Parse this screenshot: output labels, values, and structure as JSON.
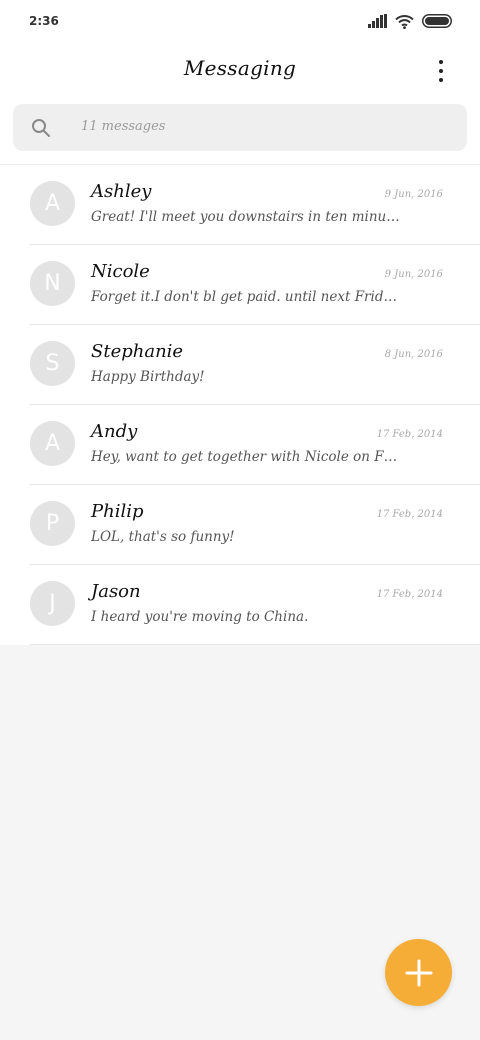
{
  "status_bar": {
    "time": "2:36",
    "icons": [
      "signal-icon",
      "wifi-icon",
      "battery-icon"
    ]
  },
  "header": {
    "title": "Messaging",
    "more_icon": "more-vertical-icon"
  },
  "search": {
    "placeholder": "11 messages",
    "icon": "search-icon"
  },
  "conversations": [
    {
      "initial": "A",
      "name": "Ashley",
      "date": "9 Jun, 2016",
      "preview": "Great! I'll meet you downstairs in ten minutes...."
    },
    {
      "initial": "N",
      "name": "Nicole",
      "date": "9 Jun, 2016",
      "preview": "Forget it.I don't bl get paid. until next Friday."
    },
    {
      "initial": "S",
      "name": "Stephanie",
      "date": "8 Jun, 2016",
      "preview": "Happy Birthday!"
    },
    {
      "initial": "A",
      "name": "Andy",
      "date": "17 Feb, 2014",
      "preview": "Hey, want to get together with Nicole on Frid..."
    },
    {
      "initial": "P",
      "name": "Philip",
      "date": "17 Feb, 2014",
      "preview": "LOL, that's so funny!"
    },
    {
      "initial": "J",
      "name": "Jason",
      "date": "17 Feb, 2014",
      "preview": "I heard you're moving to China."
    }
  ],
  "fab": {
    "icon": "plus-icon"
  },
  "colors": {
    "accent": "#f6ad37",
    "avatar_bg": "#e3e3e3",
    "background": "#f5f5f5"
  }
}
